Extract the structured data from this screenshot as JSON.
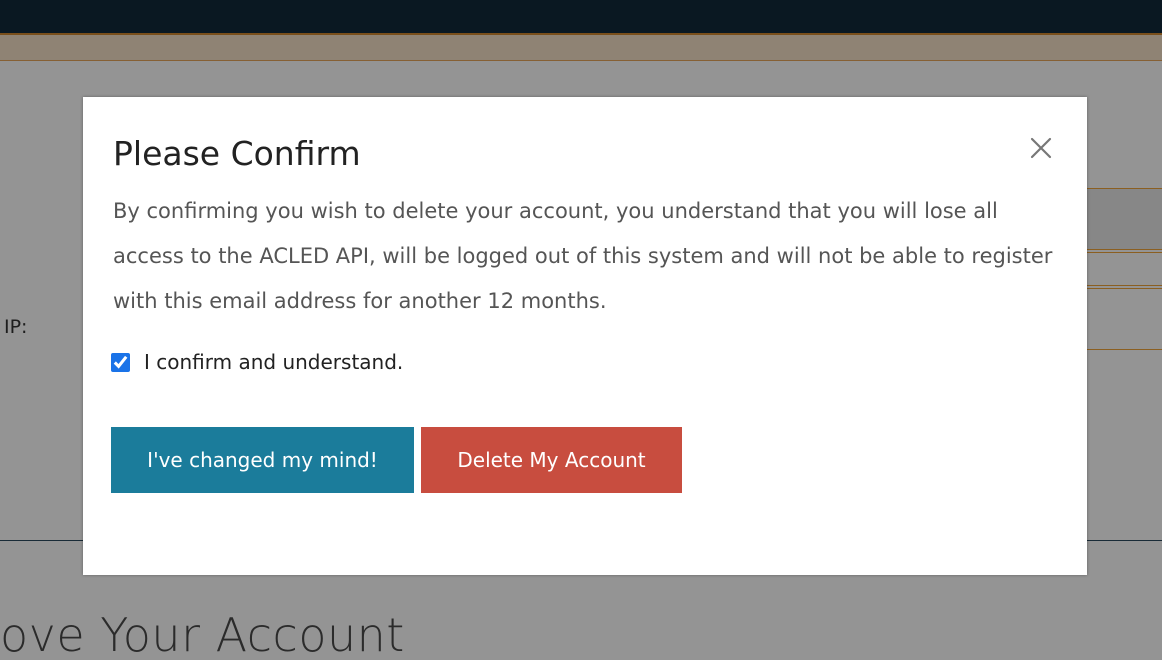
{
  "background": {
    "ip_label": "IP:",
    "section_heading": "ove Your Account"
  },
  "modal": {
    "title": "Please Confirm",
    "close_icon": "close-icon",
    "body": "By confirming you wish to delete your account, you understand that you will lose all access to the ACLED API, will be logged out of this system and will not be able to register with this email address for another 12 months.",
    "checkbox": {
      "label": "I confirm and understand.",
      "checked": true
    },
    "buttons": {
      "keep_label": "I've changed my mind!",
      "delete_label": "Delete My Account"
    }
  },
  "colors": {
    "topbar": "#122a3b",
    "accent_orange": "#d3892f",
    "keep_button": "#1b7c9b",
    "delete_button": "#c84d3f",
    "overlay": "rgba(0,0,0,0.42)"
  }
}
